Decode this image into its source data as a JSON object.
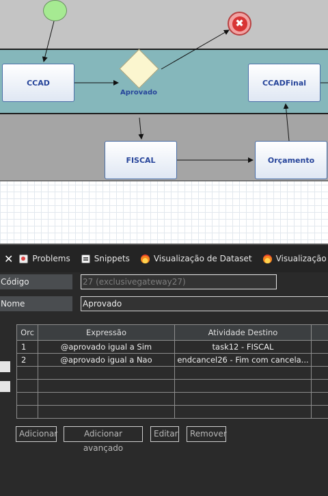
{
  "diagram": {
    "tasks": {
      "ccad": "CCAD",
      "ccad_final": "CCADFinal",
      "fiscal": "FISCAL",
      "orcamento": "Orçamento"
    },
    "gateway_label": "Aprovado",
    "end_event_glyph": "✖",
    "colors": {
      "lane_top": "#c4c4c4",
      "lane_mid": "#85b7bb",
      "lane_bottom": "#a5a5a5",
      "task_text": "#26449a",
      "start_event": "#a6ea92",
      "end_event": "#d83434",
      "gateway": "#fbf6cf"
    }
  },
  "tabs": [
    {
      "label": "Problems",
      "icon": "problems-icon"
    },
    {
      "label": "Snippets",
      "icon": "snippets-icon"
    },
    {
      "label": "Visualização de Dataset",
      "icon": "flame-icon"
    },
    {
      "label": "Visualização de Serviços",
      "icon": "flame-icon"
    }
  ],
  "tab_close_glyph": "✕",
  "properties": {
    "codigo_label": "Código",
    "codigo_value": "27 (exclusivegateway27)",
    "nome_label": "Nome",
    "nome_value": "Aprovado"
  },
  "table": {
    "headers": [
      "Orc",
      "Expressão",
      "Atividade Destino"
    ],
    "rows": [
      {
        "orc": "1",
        "expr": "@aprovado igual a Sim",
        "dest": "task12 - FISCAL"
      },
      {
        "orc": "2",
        "expr": "@aprovado igual a Nao",
        "dest": "endcancel26 - Fim com cancela..."
      }
    ]
  },
  "buttons": {
    "adicionar": "Adicionar",
    "adicionar_avancado": "Adicionar avançado",
    "editar": "Editar",
    "remover": "Remover"
  }
}
